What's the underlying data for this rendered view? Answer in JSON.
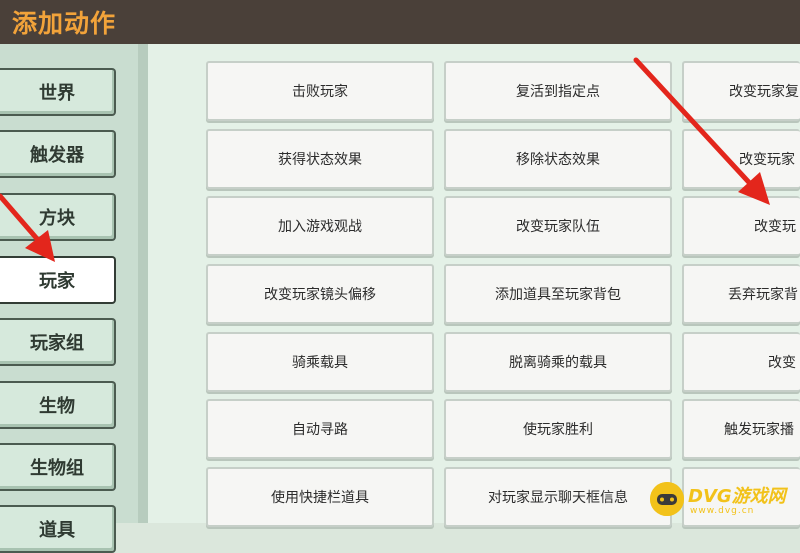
{
  "header": {
    "title": "添加动作"
  },
  "sidebar": {
    "categories": [
      "世界",
      "触发器",
      "方块",
      "玩家",
      "玩家组",
      "生物",
      "生物组",
      "道具"
    ],
    "selected": "玩家"
  },
  "actions": {
    "col1": [
      "击败玩家",
      "获得状态效果",
      "加入游戏观战",
      "改变玩家镜头偏移",
      "骑乘载具",
      "自动寻路",
      "使用快捷栏道具"
    ],
    "col2": [
      "复活到指定点",
      "移除状态效果",
      "改变玩家队伍",
      "添加道具至玩家背包",
      "脱离骑乘的载具",
      "使玩家胜利",
      "对玩家显示聊天框信息"
    ],
    "col3": [
      "改变玩家复",
      "改变玩家",
      "改变玩",
      "丢弃玩家背",
      "改变",
      "触发玩家播"
    ]
  },
  "annotations": {
    "arrow_color": "#e3261c"
  },
  "watermark": {
    "text": "DVG游戏网",
    "sub": "www.dvg.cn",
    "color": "#f2c21a"
  }
}
